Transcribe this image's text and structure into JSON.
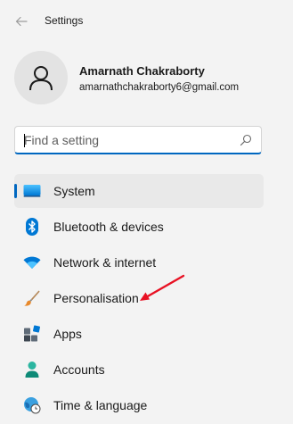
{
  "window": {
    "title": "Settings"
  },
  "user": {
    "name": "Amarnath Chakraborty",
    "email": "amarnathchakraborty6@gmail.com"
  },
  "search": {
    "placeholder": "Find a setting",
    "value": ""
  },
  "nav": {
    "items": [
      {
        "label": "System",
        "icon": "system-monitor-icon",
        "selected": true
      },
      {
        "label": "Bluetooth & devices",
        "icon": "bluetooth-icon"
      },
      {
        "label": "Network & internet",
        "icon": "wifi-icon"
      },
      {
        "label": "Personalisation",
        "icon": "paintbrush-icon"
      },
      {
        "label": "Apps",
        "icon": "apps-icon"
      },
      {
        "label": "Accounts",
        "icon": "person-icon"
      },
      {
        "label": "Time & language",
        "icon": "globe-clock-icon"
      }
    ]
  },
  "colors": {
    "accent": "#0067c0",
    "background": "#f3f3f3",
    "selected_row": "#e9e9e9",
    "annotation_arrow": "#e81123"
  }
}
